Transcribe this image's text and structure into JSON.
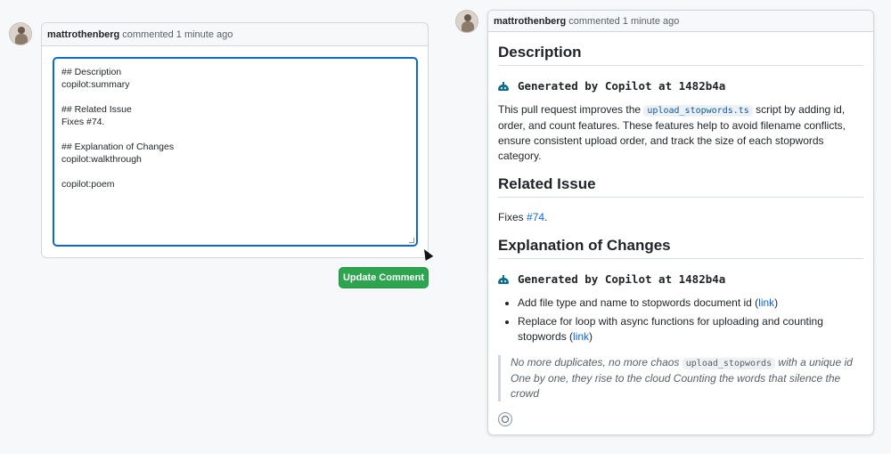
{
  "left_comment": {
    "author": "mattrothenberg",
    "action": "commented",
    "time": "1 minute ago",
    "editor_lines": [
      "## Description",
      "copilot:summary",
      "",
      "## Related Issue",
      "Fixes #74.",
      "",
      "## Explanation of Changes",
      "copilot:walkthrough",
      "",
      "copilot:poem"
    ],
    "update_button": "Update Comment"
  },
  "right_comment": {
    "author": "mattrothenberg",
    "action": "commented",
    "time": "1 minute ago",
    "description_heading": "Description",
    "generated_1": "Generated by Copilot at 1482b4a",
    "summary_pre": "This pull request improves the ",
    "summary_code": "upload_stopwords.ts",
    "summary_post": " script by adding id, order, and count features. These features help to avoid filename conflicts, ensure consistent upload order, and track the size of each stopwords category.",
    "related_heading": "Related Issue",
    "fixes_pre": "Fixes ",
    "fixes_link": "#74",
    "fixes_post": ".",
    "explanation_heading": "Explanation of Changes",
    "generated_2": "Generated by Copilot at 1482b4a",
    "bullets": [
      {
        "text": "Add file type and name to stopwords document id (",
        "link": "link",
        "after": ")"
      },
      {
        "text": "Replace for loop with async functions for uploading and counting stopwords (",
        "link": "link",
        "after": ")"
      }
    ],
    "poem_line1_pre": "No more duplicates, no more chaos ",
    "poem_code": "upload_stopwords",
    "poem_line1_post": " with a unique id",
    "poem_line2": "One by one, they rise to the cloud Counting the words that silence the crowd"
  },
  "icons": [
    "avatar",
    "copilot-bot-icon",
    "smiley-reaction-icon",
    "resize-grip-icon",
    "mouse-cursor"
  ],
  "colors": {
    "accent": "#0969da",
    "button_green": "#2da44e",
    "border": "#d0d7de"
  }
}
